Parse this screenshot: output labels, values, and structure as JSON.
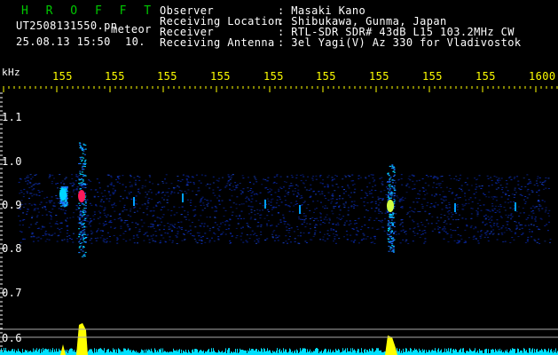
{
  "header": {
    "app_title": "H R O F F T",
    "file_name": "UT2508131550.pn",
    "file_suffix": "meteor",
    "datetime": "25.08.13 15:50",
    "count": "10.",
    "fields": [
      {
        "label": "Observer",
        "value": ": Masaki Kano"
      },
      {
        "label": "Receiving Location",
        "value": ": Shibukawa, Gunma, Japan"
      },
      {
        "label": "Receiver",
        "value": ": RTL-SDR SDR# 43dB L15 103.2MHz CW"
      },
      {
        "label": "Receiving Antenna",
        "value": ": 3el Yagi(V) Az 330 for Vladivostok"
      }
    ]
  },
  "time_axis": {
    "labels": [
      "155",
      "155",
      "155",
      "155",
      "155",
      "155",
      "155",
      "155",
      "155",
      "1600"
    ]
  },
  "freq_axis": {
    "unit": "kHz",
    "labels": [
      "1.1",
      "1.0",
      "0.9",
      "0.8",
      "0.7",
      "0.6"
    ]
  },
  "colors": {
    "title_green": "#00c800",
    "header_white": "#ffffff",
    "time_label_yellow": "#ffff00",
    "noise_blue": "#0a2ab0",
    "echo_pink": "#ff1a5a",
    "echo_cyan": "#00d8ff",
    "power_cyan": "#00e0ff",
    "power_yellow": "#ffff00"
  }
}
